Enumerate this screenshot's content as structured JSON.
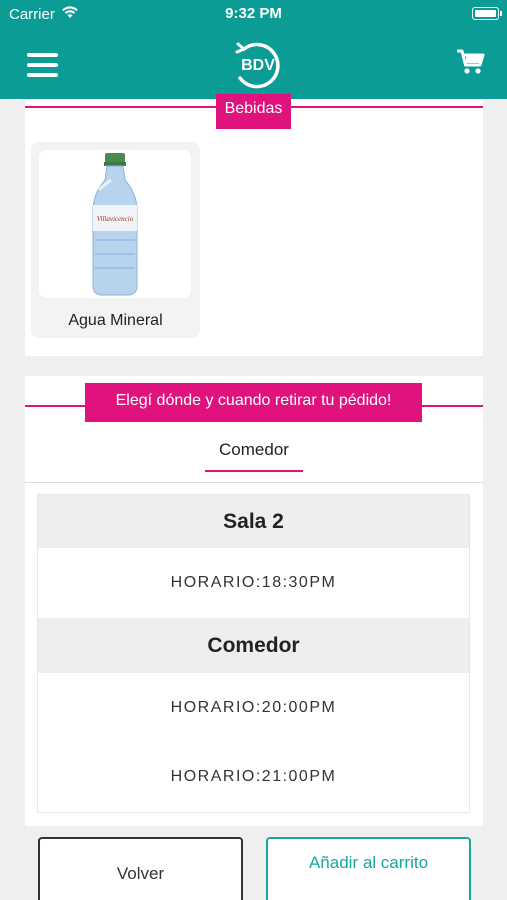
{
  "status_bar": {
    "carrier": "Carrier",
    "time": "9:32 PM"
  },
  "navbar": {
    "logo_text": "BDV",
    "menu_icon": "hamburger-menu-icon",
    "cart_icon": "cart-icon",
    "color": "#0b9c95"
  },
  "category": {
    "title": "Bebidas"
  },
  "products": [
    {
      "name": "Agua Mineral"
    }
  ],
  "pickup": {
    "title": "Elegí dónde y cuando retirar tu pédido!",
    "tabs": [
      {
        "label": "Comedor",
        "selected": true
      }
    ],
    "groups": [
      {
        "name": "Sala 2",
        "slots": [
          "HORARIO:18:30PM"
        ]
      },
      {
        "name": "Comedor",
        "slots": [
          "HORARIO:20:00PM",
          "HORARIO:21:00PM"
        ]
      }
    ]
  },
  "buttons": {
    "back": "Volver",
    "add_to_cart": "Añadir al carrito"
  },
  "colors": {
    "accent": "#e0137e",
    "teal": "#0b9c95",
    "background": "#efefef"
  }
}
